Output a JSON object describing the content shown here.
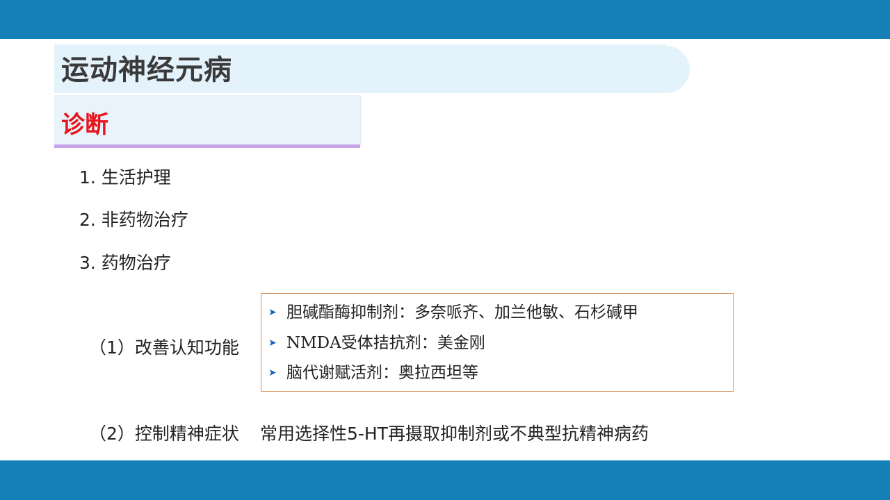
{
  "title": "运动神经元病",
  "subtitle": "诊断",
  "items": [
    "1. 生活护理",
    "2. 非药物治疗",
    "3. 药物治疗"
  ],
  "sub_items": {
    "cognition": {
      "label": "（1）改善认知功能",
      "drugs": [
        {
          "text": "胆碱酯酶抑制剂：多奈哌齐、加兰他敏、石杉碱甲"
        },
        {
          "lead": "NMDA",
          "text": "受体拮抗剂：美金刚"
        },
        {
          "text": "脑代谢赋活剂：奥拉西坦等"
        }
      ]
    },
    "psychiatric": {
      "label": "（2）控制精神症状",
      "description": "常用选择性5-HT再摄取抑制剂或不典型抗精神病药"
    }
  },
  "colors": {
    "bar": "#1580b8",
    "title_band": "#e4f2fb",
    "subtitle_text": "#e8141c",
    "subtitle_underline": "#c8a3e8",
    "box_border": "#d4915a",
    "bullet": "#1565b8"
  },
  "icons": {
    "bullet": "arrow-bullet-icon"
  }
}
